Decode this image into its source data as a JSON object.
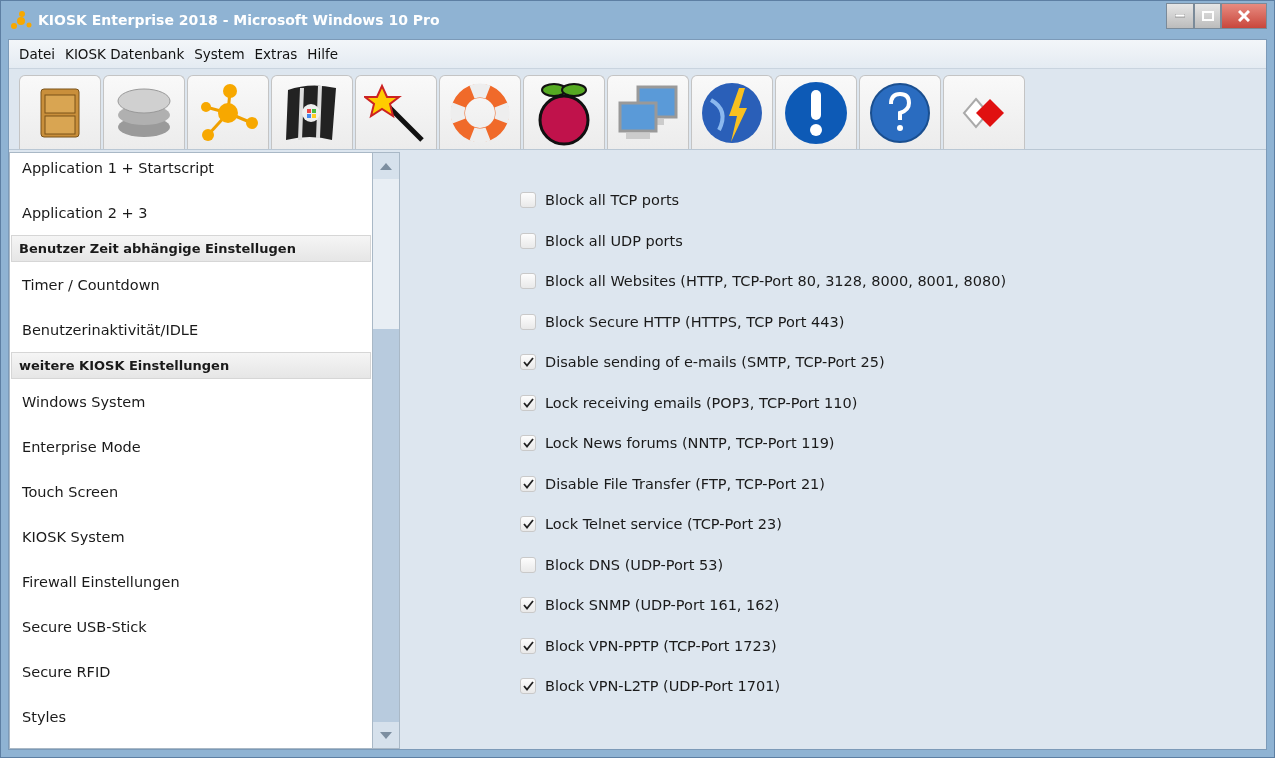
{
  "window": {
    "title": "KIOSK Enterprise 2018 - Microsoft Windows 10 Pro"
  },
  "menu": [
    "Datei",
    "KIOSK Datenbank",
    "System",
    "Extras",
    "Hilfe"
  ],
  "sidebar": {
    "items": [
      {
        "kind": "item",
        "label": "Application 1 + Startscript"
      },
      {
        "kind": "item",
        "label": "Application 2 + 3"
      },
      {
        "kind": "header",
        "label": "Benutzer Zeit abhängige Einstellugen"
      },
      {
        "kind": "item",
        "label": "Timer / Countdown"
      },
      {
        "kind": "item",
        "label": "Benutzerinaktivität/IDLE"
      },
      {
        "kind": "header",
        "label": "weitere KIOSK Einstellungen"
      },
      {
        "kind": "item",
        "label": "Windows System"
      },
      {
        "kind": "item",
        "label": "Enterprise Mode"
      },
      {
        "kind": "item",
        "label": "Touch Screen"
      },
      {
        "kind": "item",
        "label": "KIOSK System"
      },
      {
        "kind": "item",
        "label": "Firewall Einstellungen"
      },
      {
        "kind": "item",
        "label": "Secure USB-Stick"
      },
      {
        "kind": "item",
        "label": "Secure RFID"
      },
      {
        "kind": "item",
        "label": "Styles"
      }
    ]
  },
  "options": [
    {
      "label": "Block all TCP ports",
      "checked": false
    },
    {
      "label": "Block all UDP ports",
      "checked": false
    },
    {
      "label": "Block all Websites (HTTP, TCP-Port 80, 3128, 8000, 8001, 8080)",
      "checked": false
    },
    {
      "label": "Block Secure HTTP (HTTPS, TCP Port 443)",
      "checked": false
    },
    {
      "label": "Disable sending of e-mails (SMTP, TCP-Port 25)",
      "checked": true
    },
    {
      "label": "Lock receiving emails (POP3, TCP-Port 110)",
      "checked": true
    },
    {
      "label": "Lock News forums (NNTP, TCP-Port 119)",
      "checked": true
    },
    {
      "label": "Disable File Transfer (FTP, TCP-Port 21)",
      "checked": true
    },
    {
      "label": "Lock Telnet service (TCP-Port 23)",
      "checked": true
    },
    {
      "label": "Block DNS (UDP-Port 53)",
      "checked": false
    },
    {
      "label": "Block SNMP (UDP-Port 161, 162)",
      "checked": true
    },
    {
      "label": "Block VPN-PPTP (TCP-Port 1723)",
      "checked": true
    },
    {
      "label": "Block VPN-L2TP (UDP-Port 1701)",
      "checked": true
    }
  ]
}
